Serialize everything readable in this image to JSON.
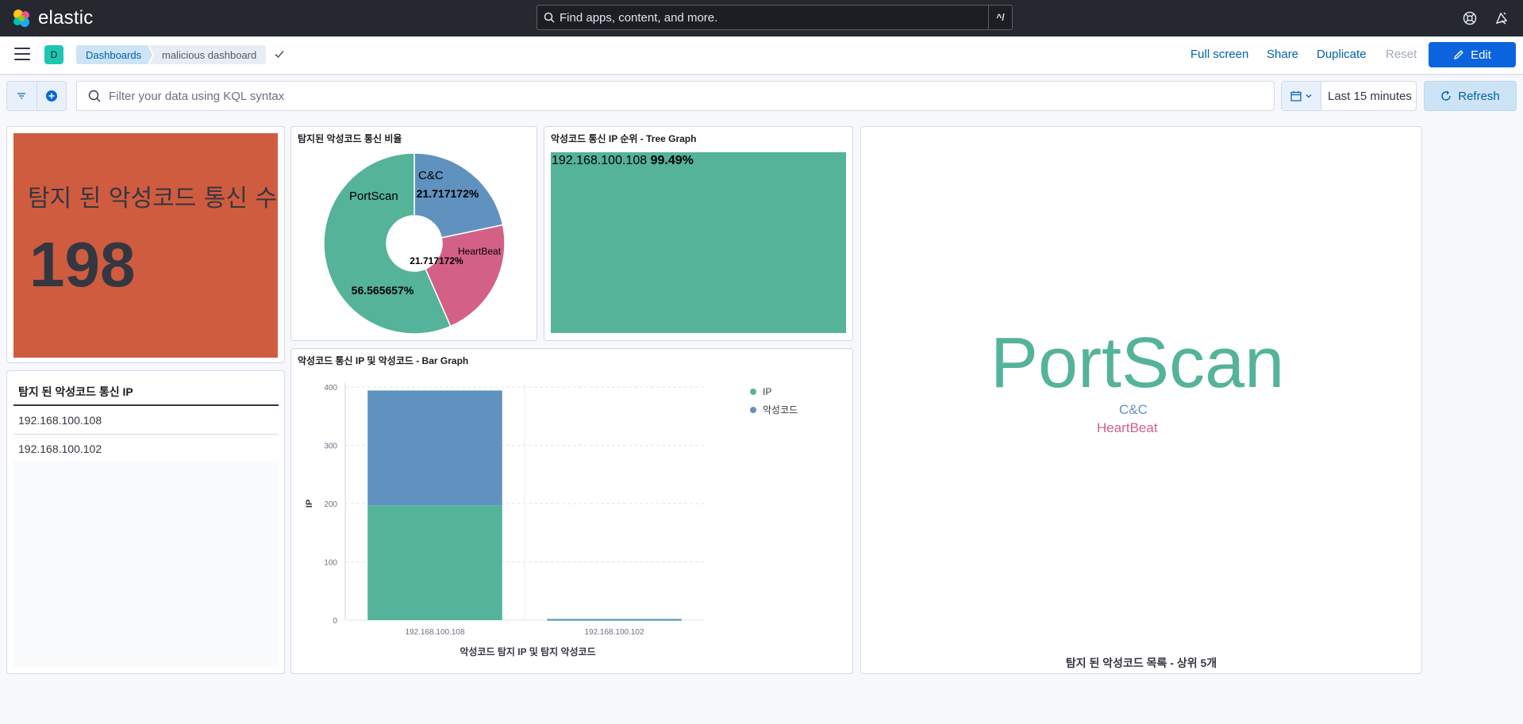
{
  "header": {
    "brand": "elastic",
    "search_placeholder": "Find apps, content, and more.",
    "search_shortcut": "^/"
  },
  "navbar": {
    "space_initial": "D",
    "breadcrumbs": [
      "Dashboards",
      "malicious dashboard"
    ],
    "actions": {
      "full_screen": "Full screen",
      "share": "Share",
      "duplicate": "Duplicate",
      "reset": "Reset",
      "edit": "Edit"
    }
  },
  "query_bar": {
    "kql_placeholder": "Filter your data using KQL syntax",
    "time_range": "Last 15 minutes",
    "refresh": "Refresh"
  },
  "panels": {
    "metric": {
      "label": "탐지 된 악성코드 통신 수",
      "value": "198",
      "color": "#d05c3f"
    },
    "ip_table": {
      "header": "탐지 된 악성코드 통신 IP",
      "rows": [
        "192.168.100.108",
        "192.168.100.102"
      ]
    },
    "pie": {
      "title": "탐지된 악성코드 통신 비율"
    },
    "treemap": {
      "title": "악성코드 통신 IP 순위 - Tree Graph",
      "ip": "192.168.100.108",
      "pct": "99.49%"
    },
    "bar": {
      "title": "악성코드 통신 IP 및 악성코드 - Bar Graph"
    },
    "tagcloud": {
      "title": "탐지 된 악성코드 목록 - 상위 5개",
      "words": [
        {
          "text": "PortScan",
          "color": "#54b399"
        },
        {
          "text": "C&C",
          "color": "#6092c0"
        },
        {
          "text": "HeartBeat",
          "color": "#d36086"
        }
      ]
    }
  },
  "chart_data": [
    {
      "type": "pie",
      "title": "탐지된 악성코드 통신 비율",
      "donut": true,
      "slices": [
        {
          "label": "PortScan",
          "value": 56.565657,
          "display": "56.565657%",
          "color": "#54b399"
        },
        {
          "label": "C&C",
          "value": 21.717172,
          "display": "21.717172%",
          "color": "#6092c0"
        },
        {
          "label": "HeartBeat",
          "value": 21.717172,
          "display": "21.717172%",
          "color": "#d36086"
        }
      ]
    },
    {
      "type": "bar",
      "stacked": true,
      "title": "악성코드 통신 IP 및 악성코드 - Bar Graph",
      "categories": [
        "192.168.100.108",
        "192.168.100.102"
      ],
      "series": [
        {
          "name": "IP",
          "values": [
            197,
            1
          ],
          "color": "#54b399"
        },
        {
          "name": "악성코드",
          "values": [
            197,
            1
          ],
          "color": "#6092c0"
        }
      ],
      "xlabel": "악성코드 탐지 IP 및 탐지 악성코드",
      "ylabel": "IP",
      "ylim": [
        0,
        400
      ],
      "yticks": [
        0,
        100,
        200,
        300,
        400
      ],
      "legend": "top-right",
      "grid": true
    }
  ]
}
